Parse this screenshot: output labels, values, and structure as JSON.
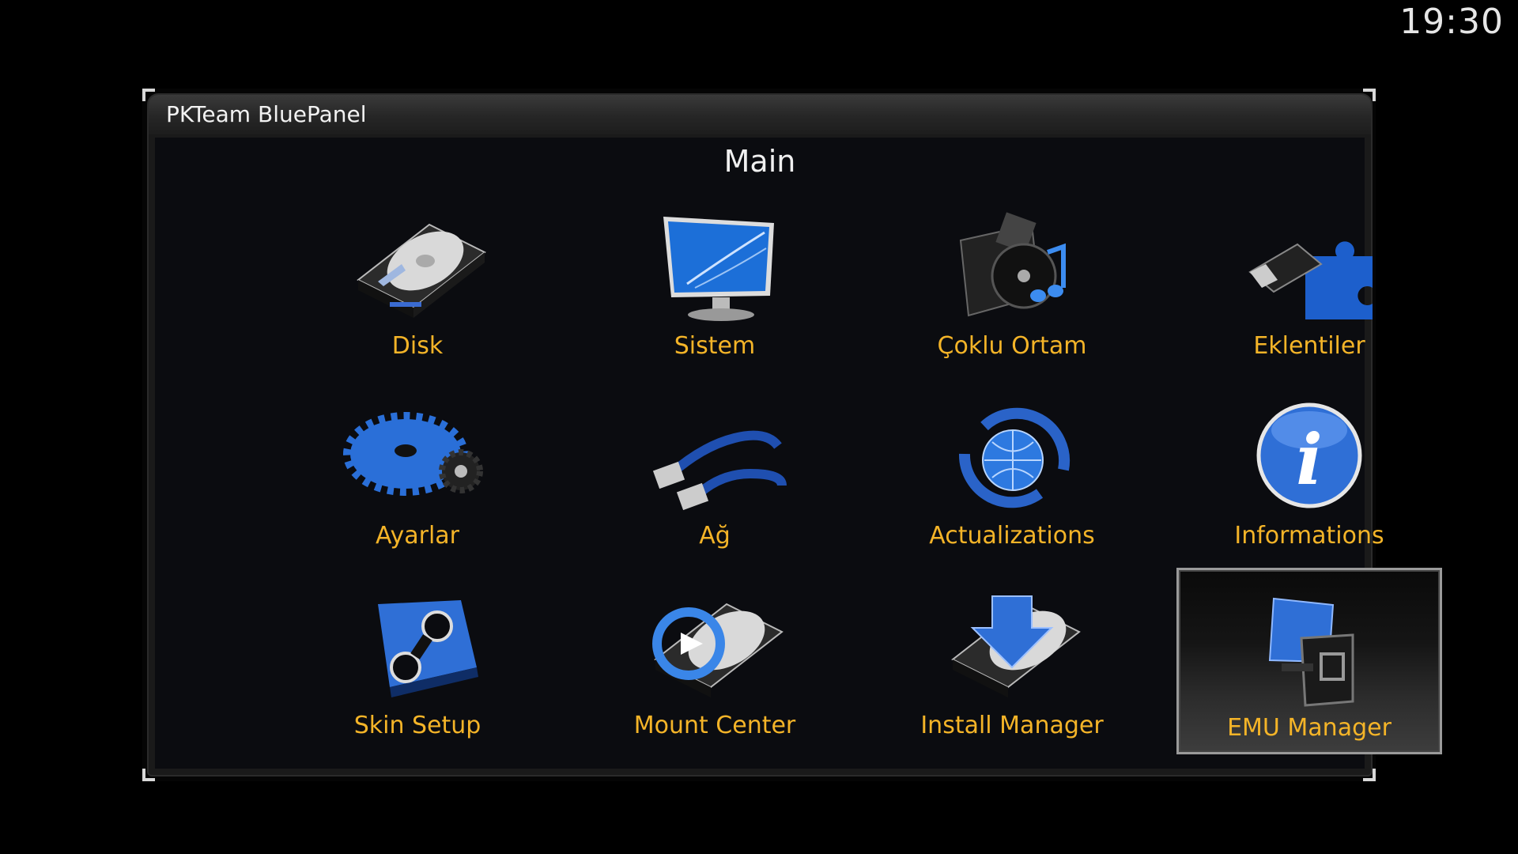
{
  "clock": "19:30",
  "window": {
    "title": "PKTeam BluePanel",
    "section_title": "Main"
  },
  "menu": {
    "items": [
      {
        "label": "Disk",
        "icon": "hard-disk-icon"
      },
      {
        "label": "Sistem",
        "icon": "monitor-icon"
      },
      {
        "label": "Çoklu Ortam",
        "icon": "multimedia-icon"
      },
      {
        "label": "Eklentiler",
        "icon": "plugin-usb-icon"
      },
      {
        "label": "Ayarlar",
        "icon": "gear-icon"
      },
      {
        "label": "Ağ",
        "icon": "network-cable-icon"
      },
      {
        "label": "Actualizations",
        "icon": "update-globe-icon"
      },
      {
        "label": "Informations",
        "icon": "info-icon"
      },
      {
        "label": "Skin Setup",
        "icon": "skin-icon"
      },
      {
        "label": "Mount Center",
        "icon": "mount-disk-icon"
      },
      {
        "label": "Install Manager",
        "icon": "install-disk-icon"
      },
      {
        "label": "EMU Manager",
        "icon": "emu-icon"
      }
    ],
    "selected_index": 11
  },
  "colors": {
    "label": "#f4b428",
    "accent_blue": "#2f6fd6",
    "background": "#0b0c10"
  }
}
